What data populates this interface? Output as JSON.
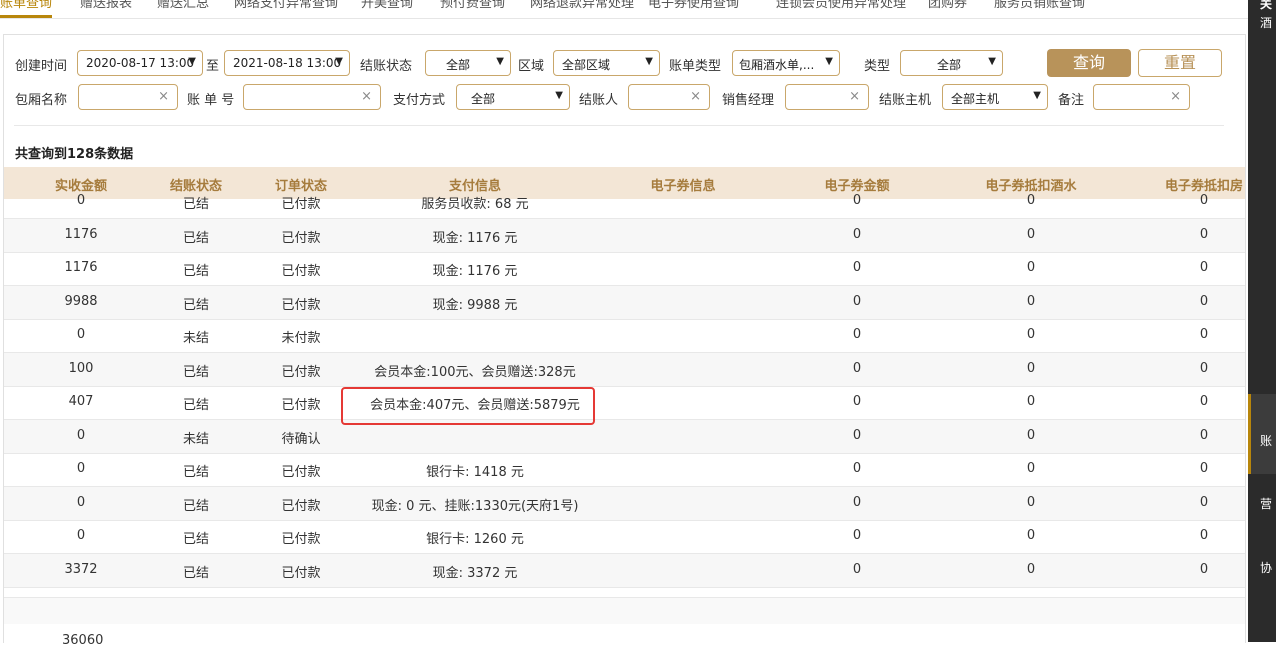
{
  "tabs": [
    "账单查询",
    "赠送报表",
    "赠送汇总",
    "网络支付异常查询",
    "开美查询",
    "预付费查询",
    "网络退款异常处理",
    "电子券使用查询",
    "连锁会员使用异常处理",
    "团购券",
    "服务员销账查询"
  ],
  "sidebar": [
    "关",
    "酒",
    "账",
    "营",
    "协"
  ],
  "filters": {
    "create_time_label": "创建时间",
    "start_time": "2020-08-17 13:00",
    "to_label": "至",
    "end_time": "2021-08-18 13:00",
    "settle_status_label": "结账状态",
    "settle_status": "全部",
    "area_label": "区域",
    "area": "全部区域",
    "bill_type_label": "账单类型",
    "bill_type": "包厢酒水单,...",
    "type_label": "类型",
    "type": "全部",
    "room_name_label": "包厢名称",
    "bill_no_label": "账 单 号",
    "pay_method_label": "支付方式",
    "pay_method": "全部",
    "settler_label": "结账人",
    "sales_mgr_label": "销售经理",
    "host_label": "结账主机",
    "host": "全部主机",
    "remark_label": "备注",
    "query_btn": "查询",
    "reset_btn": "重置",
    "clear": "×",
    "arrow": "▼"
  },
  "count_text": "共查询到128条数据",
  "table": {
    "headers": [
      "实收金额",
      "结账状态",
      "订单状态",
      "支付信息",
      "电子券信息",
      "电子券金额",
      "电子券抵扣酒水",
      "电子券抵扣房"
    ],
    "rows": [
      [
        "0",
        "已结",
        "已付款",
        "服务员收款: 68 元",
        "",
        "0",
        "0",
        "0"
      ],
      [
        "1176",
        "已结",
        "已付款",
        "现金: 1176 元",
        "",
        "0",
        "0",
        "0"
      ],
      [
        "1176",
        "已结",
        "已付款",
        "现金: 1176 元",
        "",
        "0",
        "0",
        "0"
      ],
      [
        "9988",
        "已结",
        "已付款",
        "现金: 9988 元",
        "",
        "0",
        "0",
        "0"
      ],
      [
        "0",
        "未结",
        "未付款",
        "",
        "",
        "0",
        "0",
        "0"
      ],
      [
        "100",
        "已结",
        "已付款",
        "会员本金:100元、会员赠送:328元",
        "",
        "0",
        "0",
        "0"
      ],
      [
        "407",
        "已结",
        "已付款",
        "会员本金:407元、会员赠送:5879元",
        "",
        "0",
        "0",
        "0"
      ],
      [
        "0",
        "未结",
        "待确认",
        "",
        "",
        "0",
        "0",
        "0"
      ],
      [
        "0",
        "已结",
        "已付款",
        "银行卡: 1418 元",
        "",
        "0",
        "0",
        "0"
      ],
      [
        "0",
        "已结",
        "已付款",
        "现金: 0 元、挂账:1330元(天府1号)",
        "",
        "0",
        "0",
        "0"
      ],
      [
        "0",
        "已结",
        "已付款",
        "银行卡: 1260 元",
        "",
        "0",
        "0",
        "0"
      ],
      [
        "3372",
        "已结",
        "已付款",
        "现金: 3372 元",
        "",
        "0",
        "0",
        "0"
      ]
    ],
    "total": "36060"
  }
}
